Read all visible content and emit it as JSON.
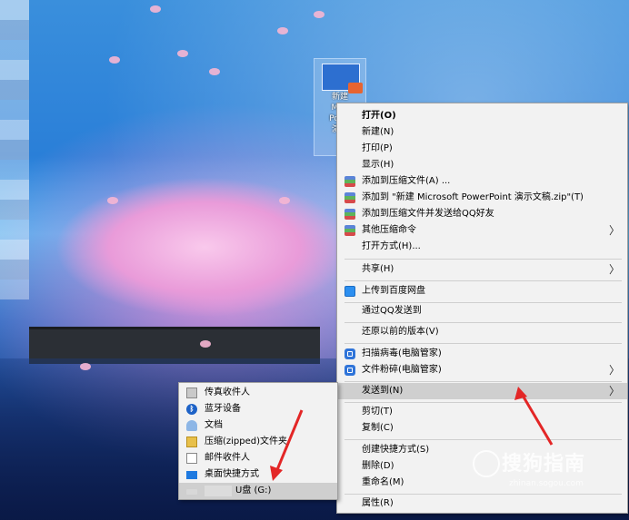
{
  "desktop_icon": {
    "label": "新建\nMicr\nPowe\n演示\nP"
  },
  "context_menu": {
    "items": [
      {
        "label": "打开(O)"
      },
      {
        "label": "新建(N)"
      },
      {
        "label": "打印(P)"
      },
      {
        "label": "显示(H)"
      },
      {
        "label": "添加到压缩文件(A) ..."
      },
      {
        "label": "添加到 \"新建 Microsoft PowerPoint 演示文稿.zip\"(T)"
      },
      {
        "label": "添加到压缩文件并发送给QQ好友"
      },
      {
        "label": "其他压缩命令"
      },
      {
        "label": "打开方式(H)..."
      },
      {
        "label": "共享(H)"
      },
      {
        "label": "上传到百度网盘"
      },
      {
        "label": "通过QQ发送到"
      },
      {
        "label": "还原以前的版本(V)"
      },
      {
        "label": "扫描病毒(电脑管家)"
      },
      {
        "label": "文件粉碎(电脑管家)"
      },
      {
        "label": "发送到(N)"
      },
      {
        "label": "剪切(T)"
      },
      {
        "label": "复制(C)"
      },
      {
        "label": "创建快捷方式(S)"
      },
      {
        "label": "删除(D)"
      },
      {
        "label": "重命名(M)"
      },
      {
        "label": "属性(R)"
      }
    ]
  },
  "send_to_menu": {
    "items": [
      {
        "label": "传真收件人"
      },
      {
        "label": "蓝牙设备"
      },
      {
        "label": "文档"
      },
      {
        "label": "压缩(zipped)文件夹"
      },
      {
        "label": "邮件收件人"
      },
      {
        "label": "桌面快捷方式"
      },
      {
        "label": "U盘 (G:)"
      }
    ]
  },
  "watermark": {
    "text": "搜狗指南",
    "url": "zhinan.sogou.com"
  },
  "colors": {
    "annotation_arrow": "#e32626",
    "menu_bg": "#f2f2f2",
    "highlight": "#cfcfcf"
  }
}
